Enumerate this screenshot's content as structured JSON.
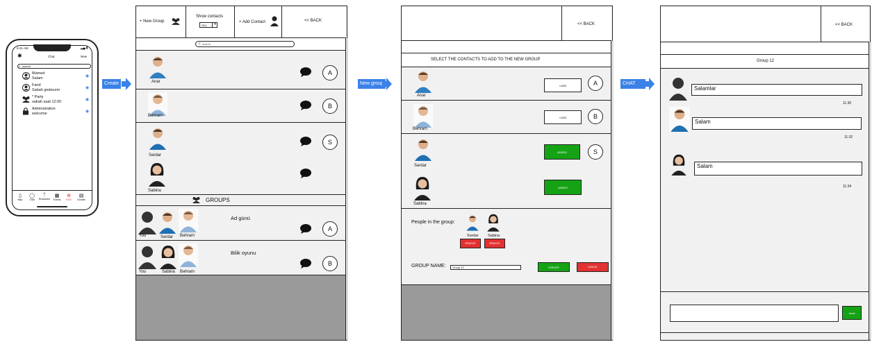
{
  "flow": {
    "create": "Create",
    "new_group": "New group",
    "chat": "CHAT"
  },
  "phone": {
    "time": "9:41 AM",
    "title": "Chat",
    "new": "New",
    "search_placeholder": "search",
    "chats": [
      {
        "name": "Mamed",
        "message": "Salam"
      },
      {
        "name": "Farid",
        "message": "Sabah gedecem"
      },
      {
        "name": "* Party",
        "message": "sabah saat 12:00"
      },
      {
        "name": "Adminstration",
        "message": "welcome"
      }
    ],
    "nav": [
      "Map",
      "Chat",
      "Broadcast",
      "Events",
      "SOS",
      "Donate"
    ]
  },
  "screen_contacts": {
    "new_group": "+ New Group",
    "show_contacts": "Show contacts",
    "show_contacts_value": "ALL",
    "add_contact": "+ Add Contact",
    "back": "<< BACK",
    "search_placeholder": "search",
    "contacts": [
      {
        "name": "Anar",
        "letter": "A"
      },
      {
        "name": "Bəhram",
        "letter": "B"
      },
      {
        "name": "Sərdar",
        "letter": "S"
      },
      {
        "name": "Sabina",
        "letter": ""
      }
    ],
    "groups_title": "GROUPS",
    "groups": [
      {
        "title": "Ad günü",
        "letter": "A",
        "members": [
          "You",
          "Sərdar",
          "Bəhram"
        ]
      },
      {
        "title": "Bilik oyunu",
        "letter": "B",
        "members": [
          "You",
          "Sabina",
          "Bəhram"
        ]
      }
    ]
  },
  "screen_select": {
    "back": "<< BACK",
    "header": "SELECT THE CONTACTS TO ADD TO THE NEW GROUP",
    "contacts": [
      {
        "name": "Anar",
        "letter": "A",
        "button": "+ADD"
      },
      {
        "name": "Bəhram",
        "letter": "B",
        "button": "+ADD"
      },
      {
        "name": "Sərdar",
        "letter": "S",
        "button": "ADDED"
      },
      {
        "name": "Sabina",
        "letter": "",
        "button": "ADDED"
      }
    ],
    "people_label": "People in the group:",
    "people": [
      {
        "name": "Sərdar",
        "remove": "REMOVE"
      },
      {
        "name": "Sabina",
        "remove": "REMOVE"
      }
    ],
    "group_name_label": "GROUP NAME:",
    "group_name_value": "Group 12",
    "create": "CREATE",
    "cancel": "CANCEL"
  },
  "screen_chat": {
    "back": "<< BACK",
    "group_title": "Group 12",
    "messages": [
      {
        "text": "Salamlar",
        "time": "11:30"
      },
      {
        "text": "Salam",
        "time": "11:32"
      },
      {
        "text": "Salam",
        "time": "11:34"
      }
    ],
    "send": "send"
  }
}
